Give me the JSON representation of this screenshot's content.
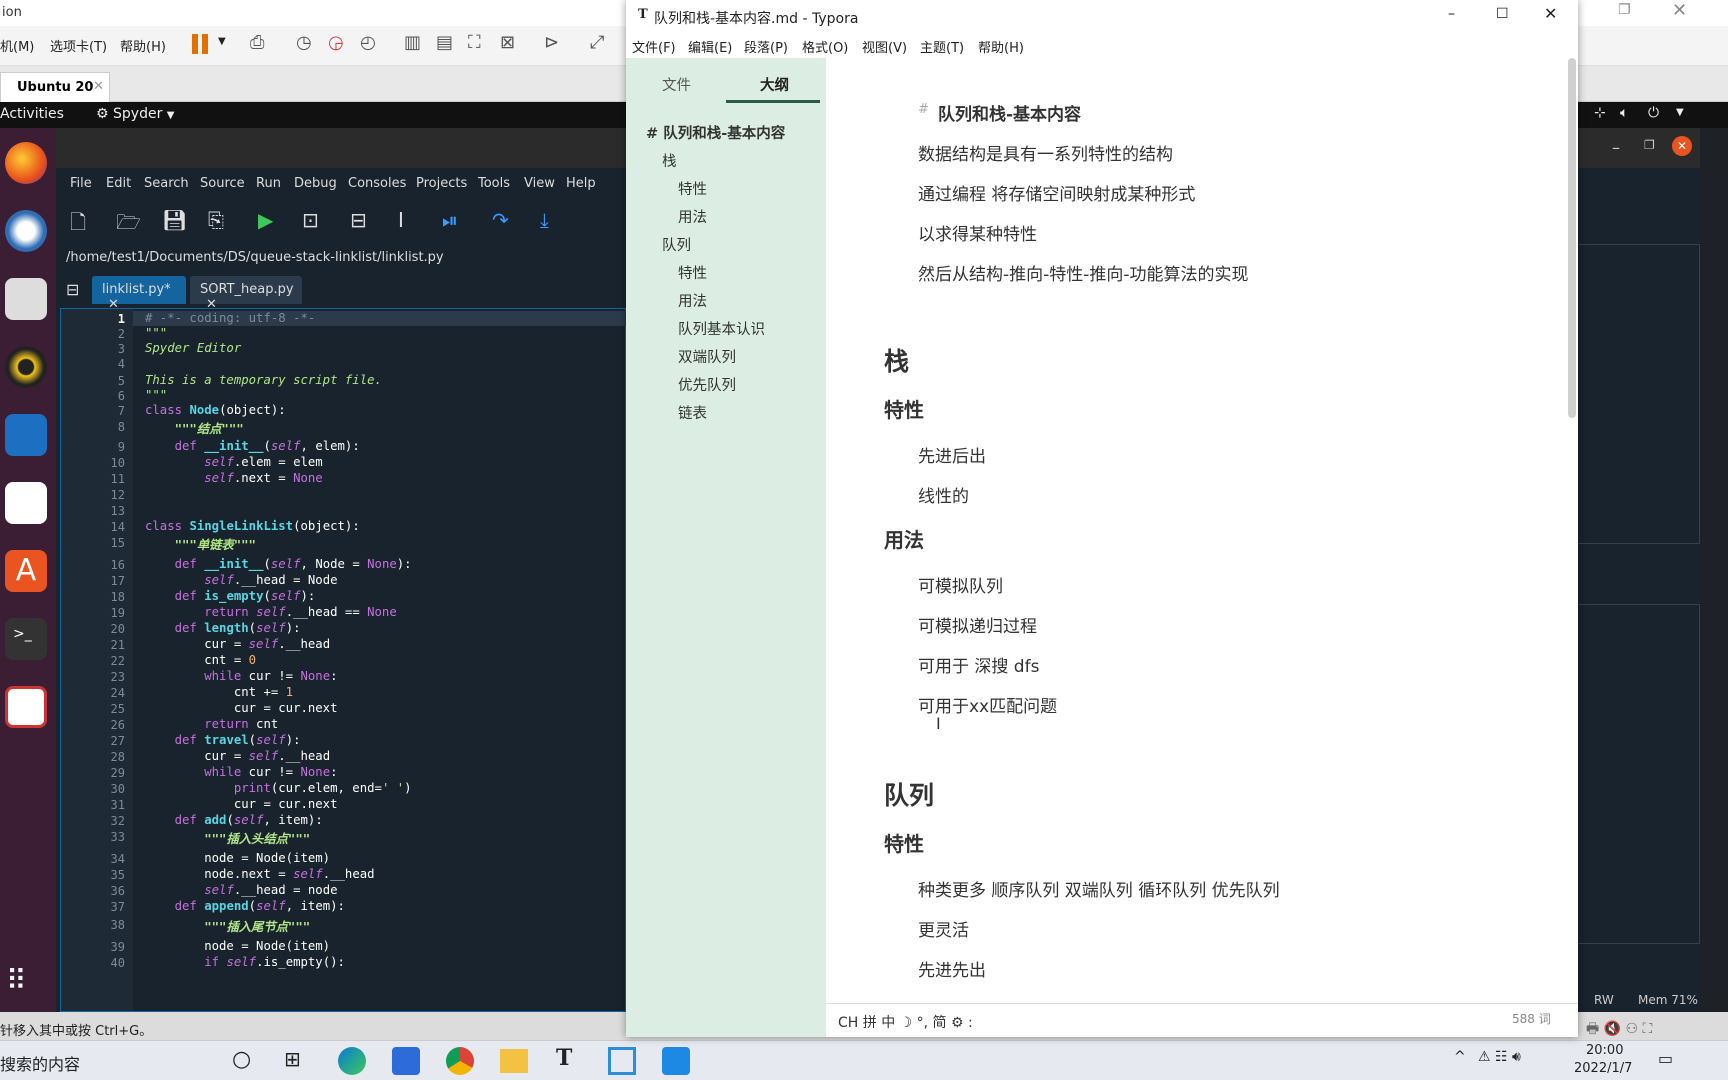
{
  "host": {
    "title_fragment": "ion",
    "menu": [
      "机(M)",
      "选项卡(T)",
      "帮助(H)"
    ],
    "vm_tab": "Ubuntu 20"
  },
  "ubuntu": {
    "activities": "Activities",
    "app_menu": "Spyder"
  },
  "spyder": {
    "menu": [
      "File",
      "Edit",
      "Search",
      "Source",
      "Run",
      "Debug",
      "Consoles",
      "Projects",
      "Tools",
      "View",
      "Help"
    ],
    "path": "/home/test1/Documents/DS/queue-stack-linklist/linklist.py",
    "tabs": [
      "linklist.py*",
      "SORT_heap.py"
    ],
    "status_rw": "RW",
    "status_mem": "Mem 71%"
  },
  "editor": {
    "lines": [
      "1",
      "2",
      "3",
      "4",
      "5",
      "6",
      "7",
      "8",
      "9",
      "10",
      "11",
      "12",
      "13",
      "14",
      "15",
      "16",
      "17",
      "18",
      "19",
      "20",
      "21",
      "22",
      "23",
      "24",
      "25",
      "26",
      "27",
      "28",
      "29",
      "30",
      "31",
      "32",
      "33",
      "34",
      "35",
      "36",
      "37",
      "38",
      "39",
      "40"
    ]
  },
  "typora": {
    "title": "队列和栈-基本内容.md - Typora",
    "menu": [
      "文件(F)",
      "编辑(E)",
      "段落(P)",
      "格式(O)",
      "视图(V)",
      "主题(T)",
      "帮助(H)"
    ],
    "side_tabs": [
      "文件",
      "大纲"
    ],
    "outline": [
      {
        "label": "# 队列和栈-基本内容",
        "level": 0
      },
      {
        "label": "栈",
        "level": 1
      },
      {
        "label": "特性",
        "level": 2
      },
      {
        "label": "用法",
        "level": 2
      },
      {
        "label": "队列",
        "level": 1
      },
      {
        "label": "特性",
        "level": 2
      },
      {
        "label": "用法",
        "level": 2
      },
      {
        "label": "队列基本认识",
        "level": 2
      },
      {
        "label": "双端队列",
        "level": 2
      },
      {
        "label": "优先队列",
        "level": 2
      },
      {
        "label": "链表",
        "level": 2
      }
    ],
    "doc": {
      "title": "队列和栈-基本内容",
      "intro": [
        "数据结构是具有一系列特性的结构",
        "通过编程 将存储空间映射成某种形式",
        "以求得某种特性",
        "然后从结构-推向-特性-推向-功能算法的实现"
      ],
      "h_stack": "栈",
      "h_feature": "特性",
      "stack_features": [
        "先进后出",
        "线性的"
      ],
      "h_usage": "用法",
      "stack_usage": [
        "可模拟队列",
        "可模拟递归过程",
        "可用于 深搜 dfs",
        "可用于xx匹配问题"
      ],
      "h_queue": "队列",
      "h_feature2": "特性",
      "queue_features": [
        "种类更多 顺序队列 双端队列 循环队列 优先队列",
        "更灵活",
        "先进先出"
      ]
    },
    "footer_left": "CH 拼 中 ☽ °, 简 ⚙ :",
    "word_count": "588 词"
  },
  "windows": {
    "status_hint": "针移入其中或按 Ctrl+G。",
    "search": "搜索的内容",
    "time": "20:00",
    "date": "2022/1/7"
  }
}
